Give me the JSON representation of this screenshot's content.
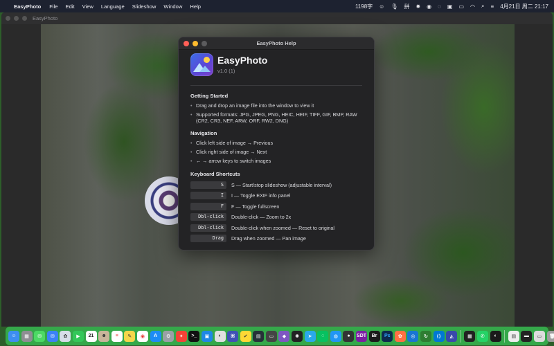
{
  "menubar": {
    "apple_icon": "apple-logo-icon",
    "app_name": "EasyPhoto",
    "menus": [
      "File",
      "Edit",
      "View",
      "Language",
      "Slideshow",
      "Window",
      "Help"
    ],
    "input_count": "1198字",
    "datetime": "4月21日 周二  21:17"
  },
  "viewer": {
    "title": "EasyPhoto"
  },
  "help": {
    "window_title": "EasyPhoto Help",
    "app_name": "EasyPhoto",
    "version": "v1.0 (1)",
    "getting_started": {
      "title": "Getting Started",
      "items": [
        "Drag and drop an image file into the window to view it",
        "Supported formats: JPG, JPEG, PNG, HEIC, HEIF, TIFF, GIF, BMP, RAW (CR2, CR3, NEF, ARW, ORF, RW2, DNG)"
      ]
    },
    "navigation": {
      "title": "Navigation",
      "items": [
        "Click left side of image → Previous",
        "Click right side of image → Next",
        "← → arrow keys to switch images"
      ]
    },
    "shortcuts": {
      "title": "Keyboard Shortcuts",
      "items": [
        {
          "key": "S",
          "desc": "S — Start/stop slideshow (adjustable interval)"
        },
        {
          "key": "I",
          "desc": "I — Toggle EXIF info panel"
        },
        {
          "key": "F",
          "desc": "F — Toggle fullscreen"
        },
        {
          "key": "Dbl-click",
          "desc": "Double-click — Zoom to 2x"
        },
        {
          "key": "Dbl-click",
          "desc": "Double-click when zoomed — Reset to original"
        },
        {
          "key": "Drag",
          "desc": "Drag when zoomed — Pan image"
        }
      ]
    }
  },
  "dock": {
    "calendar_day": "21",
    "labels": {
      "bitwarden": "BB",
      "ps": "Ps",
      "br": "Br",
      "sdt": "SDT"
    }
  }
}
